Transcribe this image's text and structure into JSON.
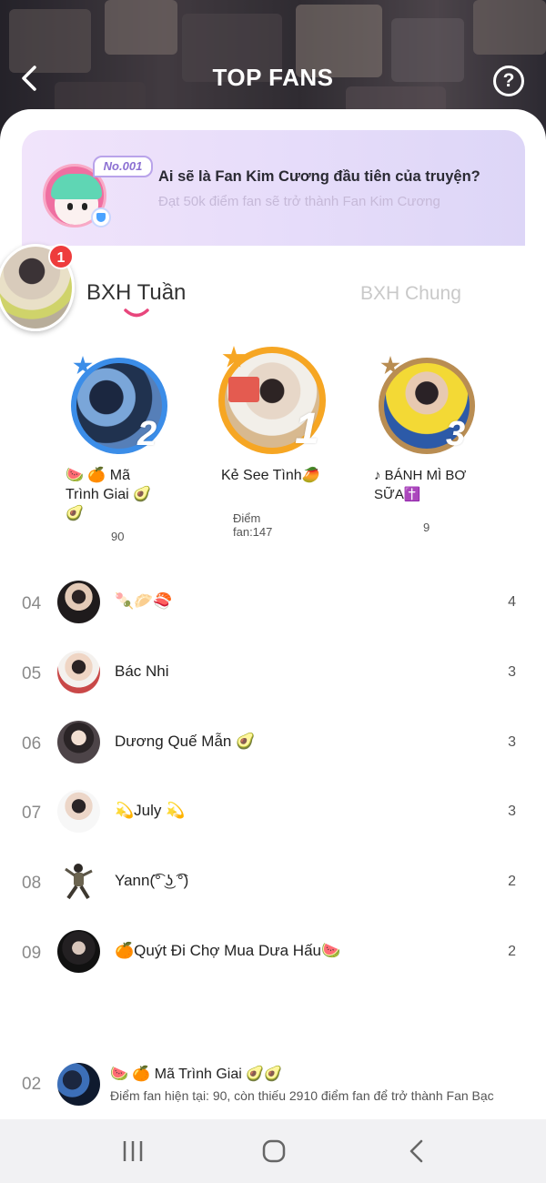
{
  "header": {
    "title": "TOP FANS",
    "help_label": "?"
  },
  "banner": {
    "badge": "No.001",
    "title": "Ai sẽ là Fan Kim Cương đầu tiên của truyện?",
    "subtitle": "Đạt 50k điểm fan sẽ trở thành Fan Kim Cương"
  },
  "floating_badge": "1",
  "tabs": [
    {
      "label": "BXH Tuần"
    },
    {
      "label": "BXH Chung"
    }
  ],
  "podium": [
    {
      "place": "2",
      "name": "🍉 🍊 Mã Trình Giai 🥑🥑",
      "score": "90"
    },
    {
      "place": "1",
      "name": "Kẻ See Tình🥭",
      "score": "Điểm fan:147"
    },
    {
      "place": "3",
      "name": "♪ BÁNH MÌ BƠ SỮA✝️",
      "score": "9"
    }
  ],
  "list": [
    {
      "rank": "04",
      "name": "🍡🥟🍣",
      "score": "4"
    },
    {
      "rank": "05",
      "name": "Bác Nhi",
      "score": "3"
    },
    {
      "rank": "06",
      "name": "Dương Quế Mẫn 🥑",
      "score": "3"
    },
    {
      "rank": "07",
      "name": "💫July 💫",
      "score": "3"
    },
    {
      "rank": "08",
      "name": "Yann(͡° ͜ʖ ͡°)",
      "score": "2"
    },
    {
      "rank": "09",
      "name": "🍊Quýt Đi Chợ Mua Dưa Hấu🍉",
      "score": "2"
    }
  ],
  "me": {
    "rank": "02",
    "name": "🍉 🍊 Mã Trình Giai 🥑🥑",
    "desc": "Điểm fan hiện tại: 90, còn thiếu 2910 điểm fan để trở thành Fan Bạc"
  },
  "colors": {
    "accent": "#e8467c",
    "gold": "#f6a623",
    "blue": "#3b8de8",
    "bronze": "#b98d52"
  }
}
